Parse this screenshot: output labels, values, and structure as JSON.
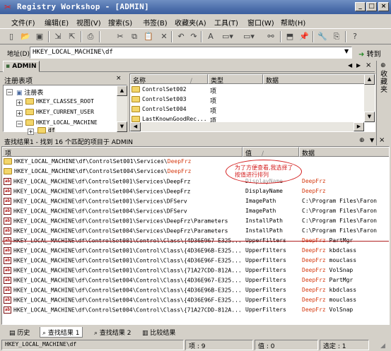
{
  "title": "Registry Workshop - [ADMIN]",
  "menu": [
    "文件(F)",
    "编辑(E)",
    "视图(V)",
    "搜索(S)",
    "书签(B)",
    "收藏夹(A)",
    "工具(T)",
    "窗口(W)",
    "帮助(H)"
  ],
  "address": {
    "label": "地址(D)",
    "value": "HKEY_LOCAL_MACHINE\\df",
    "go_label": "转到"
  },
  "tab": {
    "label": "ADMIN"
  },
  "favorites_label": "收藏夹",
  "tree": {
    "title": "注册表项",
    "items": [
      "注册表",
      "HKEY_CLASSES_ROOT",
      "HKEY_CURRENT_USER",
      "HKEY_LOCAL_MACHINE",
      "df"
    ]
  },
  "keys_pane": {
    "columns": [
      "名称",
      "类型",
      "数据"
    ],
    "rows": [
      {
        "name": "ControlSet002",
        "type": "项"
      },
      {
        "name": "ControlSet003",
        "type": "项"
      },
      {
        "name": "ControlSet004",
        "type": "项"
      },
      {
        "name": "LastKnownGoodRec...",
        "type": "项"
      }
    ]
  },
  "results": {
    "title": "查找结果1 - 找到 16 个匹配的项目于 ADMIN",
    "columns": [
      "项",
      "值",
      "数据"
    ],
    "annotation": "为了方便查看,我选择了按值进行排列",
    "rows": [
      {
        "item": "HKEY_LOCAL_MACHINE\\df\\ControlSet001\\Services\\",
        "hl": "DeepFrz",
        "value": "",
        "data": "",
        "data_hl": "",
        "data_rest": "",
        "kind": "folder"
      },
      {
        "item": "HKEY_LOCAL_MACHINE\\df\\ControlSet004\\Services\\",
        "hl": "DeepFrz",
        "value": "",
        "data": "",
        "data_hl": "",
        "data_rest": "",
        "kind": "folder"
      },
      {
        "item": "HKEY_LOCAL_MACHINE\\df\\ControlSet001\\Services\\DeepFrz",
        "hl": "",
        "value": "DisplayName",
        "data": "",
        "data_hl": "DeepFrz",
        "data_rest": "",
        "kind": "reg"
      },
      {
        "item": "HKEY_LOCAL_MACHINE\\df\\ControlSet004\\Services\\DeepFrz",
        "hl": "",
        "value": "DisplayName",
        "data": "",
        "data_hl": "DeepFrz",
        "data_rest": "",
        "kind": "reg"
      },
      {
        "item": "HKEY_LOCAL_MACHINE\\df\\ControlSet001\\Services\\DFServ",
        "hl": "",
        "value": "ImagePath",
        "data": "C:\\Program Files\\Faron",
        "data_hl": "",
        "data_rest": "",
        "kind": "reg"
      },
      {
        "item": "HKEY_LOCAL_MACHINE\\df\\ControlSet004\\Services\\DFServ",
        "hl": "",
        "value": "ImagePath",
        "data": "C:\\Program Files\\Faron",
        "data_hl": "",
        "data_rest": "",
        "kind": "reg"
      },
      {
        "item": "HKEY_LOCAL_MACHINE\\df\\ControlSet001\\Services\\DeepFrz\\Parameters",
        "hl": "",
        "value": "InstallPath",
        "data": "C:\\Program Files\\Faron",
        "data_hl": "",
        "data_rest": "",
        "kind": "reg"
      },
      {
        "item": "HKEY_LOCAL_MACHINE\\df\\ControlSet004\\Services\\DeepFrz\\Parameters",
        "hl": "",
        "value": "InstallPath",
        "data": "C:\\Program Files\\Faron",
        "data_hl": "",
        "data_rest": "",
        "kind": "reg"
      },
      {
        "item": "HKEY_LOCAL_MACHINE\\df\\ControlSet001\\Control\\Class\\{4D36E967-E325...",
        "hl": "",
        "value": "UpperFilters",
        "data": "",
        "data_hl": "DeepFrz",
        "data_rest": " PartMgr",
        "kind": "reg"
      },
      {
        "item": "HKEY_LOCAL_MACHINE\\df\\ControlSet001\\Control\\Class\\{4D36E96B-E325...",
        "hl": "",
        "value": "UpperFilters",
        "data": "",
        "data_hl": "DeepFrz",
        "data_rest": " kbdclass",
        "kind": "reg"
      },
      {
        "item": "HKEY_LOCAL_MACHINE\\df\\ControlSet001\\Control\\Class\\{4D36E96F-E325...",
        "hl": "",
        "value": "UpperFilters",
        "data": "",
        "data_hl": "DeepFrz",
        "data_rest": " mouclass",
        "kind": "reg"
      },
      {
        "item": "HKEY_LOCAL_MACHINE\\df\\ControlSet001\\Control\\Class\\{71A27CDD-812A...",
        "hl": "",
        "value": "UpperFilters",
        "data": "",
        "data_hl": "DeepFrz",
        "data_rest": " VolSnap",
        "kind": "reg"
      },
      {
        "item": "HKEY_LOCAL_MACHINE\\df\\ControlSet004\\Control\\Class\\{4D36E967-E325...",
        "hl": "",
        "value": "UpperFilters",
        "data": "",
        "data_hl": "DeepFrz",
        "data_rest": " PartMgr",
        "kind": "reg"
      },
      {
        "item": "HKEY_LOCAL_MACHINE\\df\\ControlSet004\\Control\\Class\\{4D36E96B-E325...",
        "hl": "",
        "value": "UpperFilters",
        "data": "",
        "data_hl": "DeepFrz",
        "data_rest": " kbdclass",
        "kind": "reg"
      },
      {
        "item": "HKEY_LOCAL_MACHINE\\df\\ControlSet004\\Control\\Class\\{4D36E96F-E325...",
        "hl": "",
        "value": "UpperFilters",
        "data": "",
        "data_hl": "DeepFrz",
        "data_rest": " mouclass",
        "kind": "reg"
      },
      {
        "item": "HKEY_LOCAL_MACHINE\\df\\ControlSet004\\Control\\Class\\{71A27CDD-812A...",
        "hl": "",
        "value": "UpperFilters",
        "data": "",
        "data_hl": "DeepFrz",
        "data_rest": " VolSnap",
        "kind": "reg"
      }
    ]
  },
  "bottom_tabs": [
    "历史",
    "查找结果 1",
    "查找结果 2",
    "比较结果"
  ],
  "status": {
    "path": "HKEY_LOCAL_MACHINE\\df",
    "items": "项 : 9",
    "values": "值 : 0",
    "selected": "选定 : 1"
  },
  "colors": {
    "highlight": "#d43a10",
    "annotation": "#d42020",
    "title_gradient": "#4d6fab"
  }
}
